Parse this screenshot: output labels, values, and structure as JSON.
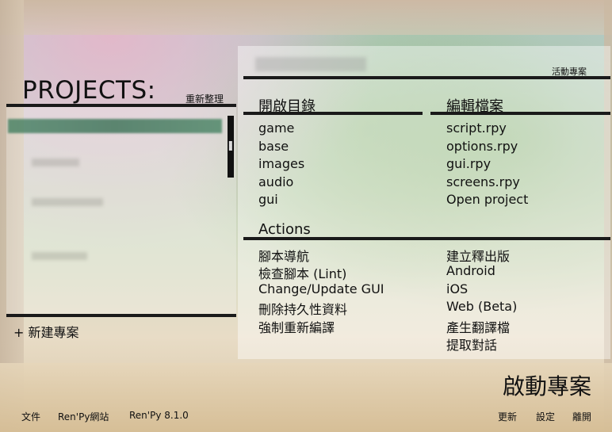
{
  "projects": {
    "title": "PROJECTS:",
    "refresh_label": "重新整理",
    "new_project_label": "+ 新建專案"
  },
  "active_project": {
    "label": "活動專案"
  },
  "open_directory": {
    "heading": "開啟目錄",
    "items": [
      "game",
      "base",
      "images",
      "audio",
      "gui"
    ]
  },
  "edit_files": {
    "heading": "編輯檔案",
    "items": [
      "script.rpy",
      "options.rpy",
      "gui.rpy",
      "screens.rpy",
      "Open project"
    ]
  },
  "actions": {
    "heading": "Actions",
    "left": [
      "腳本導航",
      "檢查腳本 (Lint)",
      "Change/Update GUI",
      "刪除持久性資料",
      "強制重新編譯"
    ],
    "right": [
      "建立釋出版",
      "Android",
      "iOS",
      "Web (Beta)",
      "產生翻譯檔",
      "提取對話"
    ]
  },
  "launch_label": "啟動專案",
  "footer": {
    "docs": "文件",
    "website": "Ren'Py網站",
    "version": "Ren'Py 8.1.0",
    "update": "更新",
    "preferences": "設定",
    "quit": "離開"
  }
}
